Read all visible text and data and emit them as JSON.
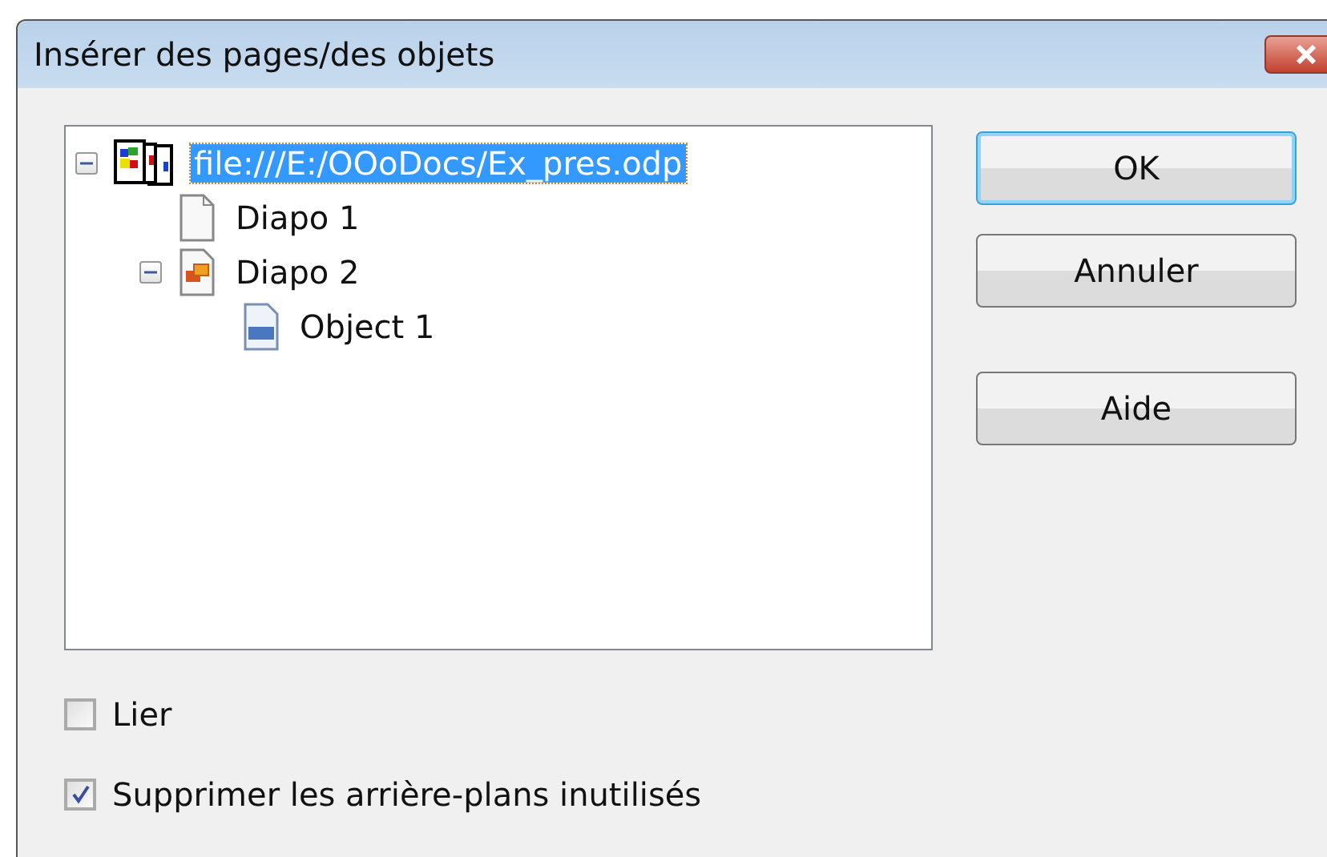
{
  "window": {
    "title": "Insérer des pages/des objets"
  },
  "tree": [
    {
      "label": "file:///E:/OOoDocs/Ex_pres.odp",
      "kind": "document",
      "selected": true,
      "expanded": true,
      "children": [
        {
          "label": "Diapo 1",
          "kind": "page",
          "selected": false
        },
        {
          "label": "Diapo 2",
          "kind": "slide",
          "selected": false,
          "expanded": true,
          "children": [
            {
              "label": "Object 1",
              "kind": "ole",
              "selected": false
            }
          ]
        }
      ]
    }
  ],
  "buttons": [
    {
      "label": "OK",
      "default": true
    },
    {
      "label": "Annuler",
      "default": false
    },
    {
      "label": "Aide",
      "default": false
    }
  ],
  "options": [
    {
      "label": "Lier",
      "checked": false
    },
    {
      "label": "Supprimer les arrière-plans inutilisés",
      "checked": true
    }
  ]
}
